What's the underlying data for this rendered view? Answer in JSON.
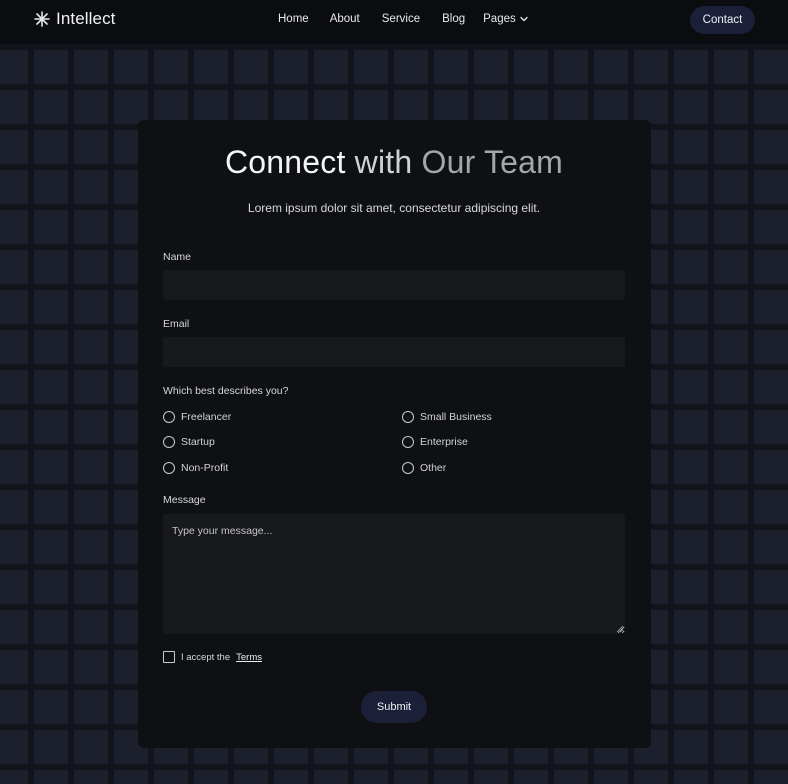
{
  "brand": {
    "name": "Intellect",
    "icon": "asterisk-icon"
  },
  "nav": {
    "items": [
      {
        "label": "Home"
      },
      {
        "label": "About"
      },
      {
        "label": "Service"
      },
      {
        "label": "Blog"
      },
      {
        "label": "Pages"
      }
    ],
    "contact_label": "Contact"
  },
  "form": {
    "title_part1": "Connect",
    "title_part2": "with",
    "title_part3": "Our Team",
    "subtitle": "Lorem ipsum dolor sit amet, consectetur adipiscing elit.",
    "name_label": "Name",
    "email_label": "Email",
    "describe_label": "Which best describes you?",
    "options": [
      {
        "label": "Freelancer"
      },
      {
        "label": "Small Business"
      },
      {
        "label": "Startup"
      },
      {
        "label": "Enterprise"
      },
      {
        "label": "Non-Profit"
      },
      {
        "label": "Other"
      }
    ],
    "message_label": "Message",
    "message_placeholder": "Type your message...",
    "terms_prefix": "I accept the",
    "terms_link": "Terms",
    "submit_label": "Submit"
  },
  "colors": {
    "accent": "#1b2038",
    "card": "#0f1013",
    "background": "#12141c"
  }
}
